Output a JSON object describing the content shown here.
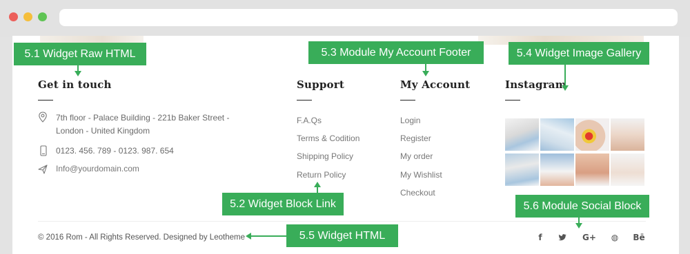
{
  "colors": {
    "annotation_green": "#39ad59",
    "heading": "#222222",
    "body_text": "#6a6a6a"
  },
  "contact": {
    "title": "Get in touch",
    "address_line1": "7th floor - Palace Building - 221b Baker Street -",
    "address_line2": "London - United Kingdom",
    "phone": "0123. 456. 789  -  0123. 987. 654",
    "email": "Info@yourdomain.com",
    "icons": [
      "map-pin-icon",
      "phone-icon",
      "paper-plane-icon"
    ]
  },
  "support": {
    "title": "Support",
    "links": [
      "F.A.Qs",
      "Terms & Codition",
      "Shipping Policy",
      "Return Policy"
    ]
  },
  "account": {
    "title": "My Account",
    "links": [
      "Login",
      "Register",
      "My order",
      "My Wishlist",
      "Checkout"
    ]
  },
  "instagram": {
    "title": "Instagram"
  },
  "footer": {
    "copyright": "© 2016 Rom - All Rights Reserved. Designed by Leotheme",
    "social": [
      {
        "icon": "facebook-icon",
        "glyph": "f"
      },
      {
        "icon": "twitter-icon",
        "glyph": "🐦"
      },
      {
        "icon": "google-plus-icon",
        "glyph": "G+"
      },
      {
        "icon": "dribbble-icon",
        "glyph": "◍"
      },
      {
        "icon": "behance-icon",
        "glyph": "Bē"
      }
    ]
  },
  "annotations": {
    "raw_html": "5.1 Widget Raw HTML",
    "block_link": "5.2 Widget Block Link",
    "account_footer": "5.3 Module My Account Footer",
    "image_gallery": "5.4 Widget Image Gallery",
    "html": "5.5 Widget HTML",
    "social_block": "5.6 Module Social Block"
  }
}
